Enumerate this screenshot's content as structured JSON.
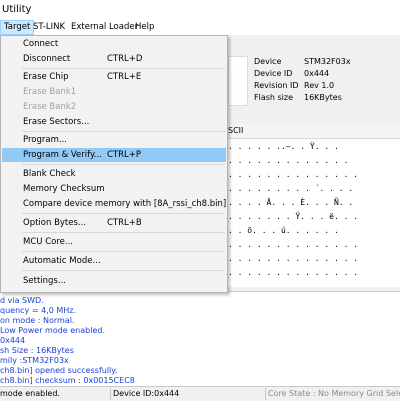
{
  "window": {
    "title": "Utility"
  },
  "menubar": {
    "items": [
      "Target",
      "ST-LINK",
      "External Loader",
      "Help"
    ]
  },
  "device_info": {
    "rows": [
      {
        "key": "Device",
        "value": "STM32F03x"
      },
      {
        "key": "Device ID",
        "value": "0x444"
      },
      {
        "key": "Revision ID",
        "value": "Rev 1.0"
      },
      {
        "key": "Flash size",
        "value": "16KBytes"
      }
    ]
  },
  "memory": {
    "header": "SCII",
    "rows": [
      ". . . . . ..—. . Ÿ. . .",
      ". . . . . . . . . . . . .",
      ". . . . . . . . . . . . . .",
      ". . . . . . . . . ´. . . .",
      ". . . . Ä. . . È. . . Ñ. .",
      ". . . . . . . Ÿ. . . ë. . .",
      ". . ö. . . ú. . . . . .",
      ". . . . . . . . . . . . . .",
      ". . . . . . . . . . . . . .",
      ". . . . . . . . . . . . . ."
    ]
  },
  "target_menu": {
    "items": [
      {
        "label": "Connect",
        "shortcut": "",
        "disabled": false
      },
      {
        "label": "Disconnect",
        "shortcut": "CTRL+D",
        "disabled": false
      },
      {
        "label": "Erase Chip",
        "shortcut": "CTRL+E",
        "disabled": false
      },
      {
        "label": "Erase Bank1",
        "shortcut": "",
        "disabled": true
      },
      {
        "label": "Erase Bank2",
        "shortcut": "",
        "disabled": true
      },
      {
        "label": "Erase Sectors...",
        "shortcut": "",
        "disabled": false
      },
      {
        "label": "Program...",
        "shortcut": "",
        "disabled": false
      },
      {
        "label": "Program & Verify...",
        "shortcut": "CTRL+P",
        "disabled": false,
        "highlighted": true
      },
      {
        "label": "Blank Check",
        "shortcut": "",
        "disabled": false
      },
      {
        "label": "Memory Checksum",
        "shortcut": "",
        "disabled": false
      },
      {
        "label": "Compare device memory with [8A_rssi_ch8.bin]",
        "shortcut": "",
        "disabled": false
      },
      {
        "label": "Option Bytes...",
        "shortcut": "CTRL+B",
        "disabled": false
      },
      {
        "label": "MCU Core...",
        "shortcut": "",
        "disabled": false
      },
      {
        "label": "Automatic Mode...",
        "shortcut": "",
        "disabled": false
      },
      {
        "label": "Settings...",
        "shortcut": "",
        "disabled": false
      }
    ]
  },
  "log": {
    "lines": [
      "d via SWD.",
      "quency = 4,0 MHz.",
      "on mode : Normal.",
      "Low Power mode enabled.",
      "0x444",
      "sh Size : 16KBytes",
      "mily :STM32F03x",
      "ch8.bin] opened successfully.",
      "ch8.bin] checksum : 0x0015CEC8"
    ]
  },
  "status": {
    "mode": "mode enabled.",
    "device_id": "Device ID:0x444",
    "core_state": "Core State : No Memory Grid Sele"
  }
}
